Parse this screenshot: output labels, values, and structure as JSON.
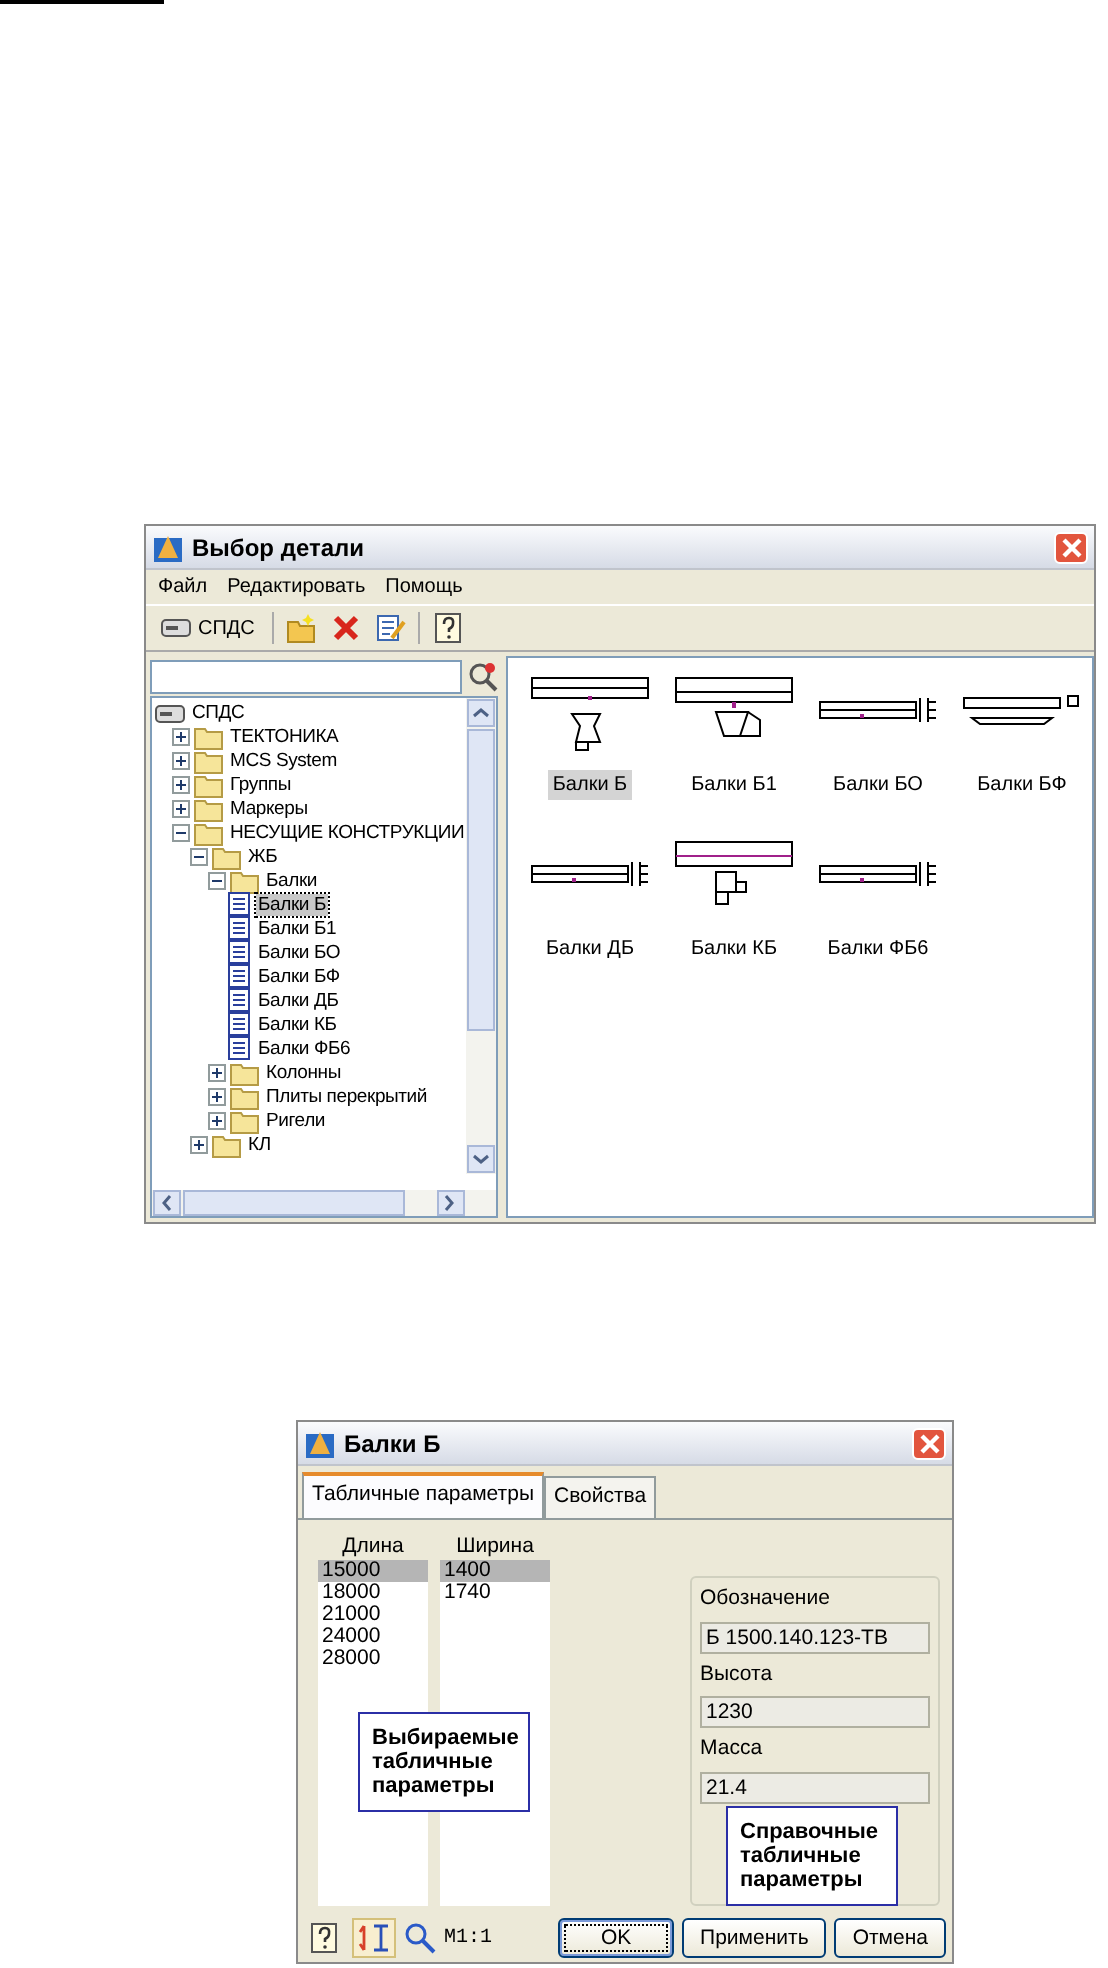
{
  "part_selector": {
    "title": "Выбор детали",
    "menu": [
      "Файл",
      "Редактировать",
      "Помощь"
    ],
    "toolbar": {
      "root_button": "СПДС"
    },
    "tree": [
      {
        "label": "СПДС",
        "kind": "root",
        "selected": false,
        "children": [
          {
            "label": "ТЕКТОНИКА",
            "kind": "folder",
            "expanded": false,
            "selected": false
          },
          {
            "label": "MCS System",
            "kind": "folder",
            "expanded": false,
            "selected": false
          },
          {
            "label": "Группы",
            "kind": "folder",
            "expanded": false,
            "selected": false
          },
          {
            "label": "Маркеры",
            "kind": "folder",
            "expanded": false,
            "selected": false
          },
          {
            "label": "НЕСУЩИЕ КОНСТРУКЦИИ",
            "kind": "folder",
            "expanded": true,
            "selected": false,
            "children": [
              {
                "label": "ЖБ",
                "kind": "folder",
                "expanded": true,
                "selected": false,
                "children": [
                  {
                    "label": "Балки",
                    "kind": "folder",
                    "expanded": true,
                    "selected": false,
                    "children": [
                      {
                        "label": "Балки Б",
                        "kind": "item",
                        "selected": true
                      },
                      {
                        "label": "Балки Б1",
                        "kind": "item",
                        "selected": false
                      },
                      {
                        "label": "Балки БО",
                        "kind": "item",
                        "selected": false
                      },
                      {
                        "label": "Балки БФ",
                        "kind": "item",
                        "selected": false
                      },
                      {
                        "label": "Балки ДБ",
                        "kind": "item",
                        "selected": false
                      },
                      {
                        "label": "Балки КБ",
                        "kind": "item",
                        "selected": false
                      },
                      {
                        "label": "Балки ФБ6",
                        "kind": "item",
                        "selected": false
                      }
                    ]
                  },
                  {
                    "label": "Колонны",
                    "kind": "folder",
                    "expanded": false,
                    "selected": false
                  },
                  {
                    "label": "Плиты перекрытий",
                    "kind": "folder",
                    "expanded": false,
                    "selected": false
                  },
                  {
                    "label": "Ригели",
                    "kind": "folder",
                    "expanded": false,
                    "selected": false
                  }
                ]
              },
              {
                "label": "КЛ",
                "kind": "folder",
                "expanded": false,
                "selected": false
              }
            ]
          }
        ]
      }
    ],
    "thumbnails": [
      {
        "label": "Балки Б",
        "kind": "hourglass",
        "selected": true
      },
      {
        "label": "Балки Б1",
        "kind": "wedge",
        "selected": false
      },
      {
        "label": "Балки БО",
        "kind": "dimensioned",
        "selected": false
      },
      {
        "label": "Балки БФ",
        "kind": "flanged",
        "selected": false
      },
      {
        "label": "Балки ДБ",
        "kind": "dimensioned",
        "selected": false
      },
      {
        "label": "Балки КБ",
        "kind": "stepped",
        "selected": false
      },
      {
        "label": "Балки ФБ6",
        "kind": "dimensioned",
        "selected": false
      }
    ]
  },
  "detail_dialog": {
    "title": "Балки Б",
    "tabs": [
      {
        "label": "Табличные параметры",
        "selected": true
      },
      {
        "label": "Свойства",
        "selected": false
      }
    ],
    "columns": [
      {
        "header": "Длина",
        "values": [
          {
            "text": "15000",
            "selected": true
          },
          {
            "text": "18000",
            "selected": false
          },
          {
            "text": "21000",
            "selected": false
          },
          {
            "text": "24000",
            "selected": false
          },
          {
            "text": "28000",
            "selected": false
          }
        ]
      },
      {
        "header": "Ширина",
        "values": [
          {
            "text": "1400",
            "selected": true
          },
          {
            "text": "1740",
            "selected": false
          }
        ]
      }
    ],
    "reference": [
      {
        "label": "Обозначение",
        "value": "Б 1500.140.123-ТВ"
      },
      {
        "label": "Высота",
        "value": "1230"
      },
      {
        "label": "Масса",
        "value": "21.4"
      }
    ],
    "callouts": [
      "Выбираемые табличные параметры",
      "Справочные табличные параметры"
    ],
    "footer": {
      "layout_toggle_pressed": true,
      "scale": "М1:1"
    },
    "buttons": [
      {
        "label": "OK",
        "default": true
      },
      {
        "label": "Применить",
        "default": false
      },
      {
        "label": "Отмена",
        "default": false
      }
    ]
  }
}
